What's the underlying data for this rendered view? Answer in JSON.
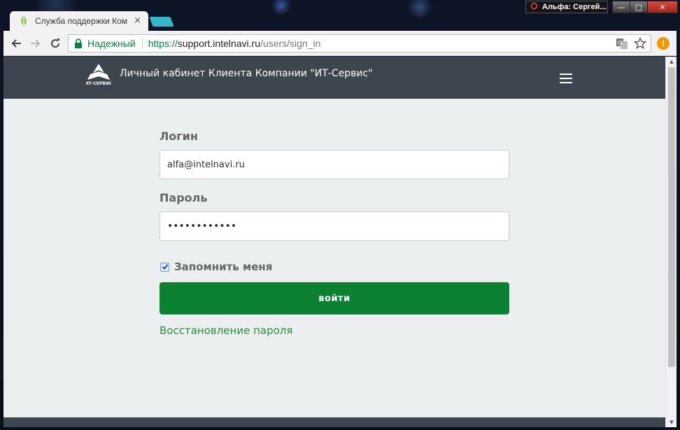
{
  "browser": {
    "tab_title": "Служба поддержки Ком",
    "tab_close": "×",
    "profile_name": "Альфа: Сергей...",
    "secure_label": "Надежный",
    "url_scheme": "https://",
    "url_host": "support.intelnavi.ru",
    "url_path": "/users/sign_in",
    "extension_badge": "!",
    "window_controls": {
      "minimize": "—",
      "maximize": "□",
      "close": "✕"
    }
  },
  "header": {
    "brand": "Личный кабинет Клиента Компании \"ИТ-Сервис\"",
    "logo_text": "ИТ-СЕРВИС"
  },
  "login_form": {
    "login_label": "Логин",
    "login_value": "alfa@intelnavi.ru",
    "password_label": "Пароль",
    "password_value": "••••••••••••",
    "remember_label": "Запомнить меня",
    "remember_checked": true,
    "submit_label": "войти",
    "restore_link": "Восстановление пароля"
  },
  "colors": {
    "navbar": "#3d464f",
    "page_bg": "#ecefef",
    "submit": "#0a8231",
    "link": "#2e8b3a",
    "secure": "#0b8043"
  },
  "icons": {
    "tab": "app-leaf-icon",
    "back": "arrow-left-icon",
    "forward": "arrow-right-icon",
    "reload": "reload-icon",
    "lock": "lock-icon",
    "translate": "translate-icon",
    "bookmark": "star-icon",
    "menu": "hamburger-menu-icon"
  }
}
